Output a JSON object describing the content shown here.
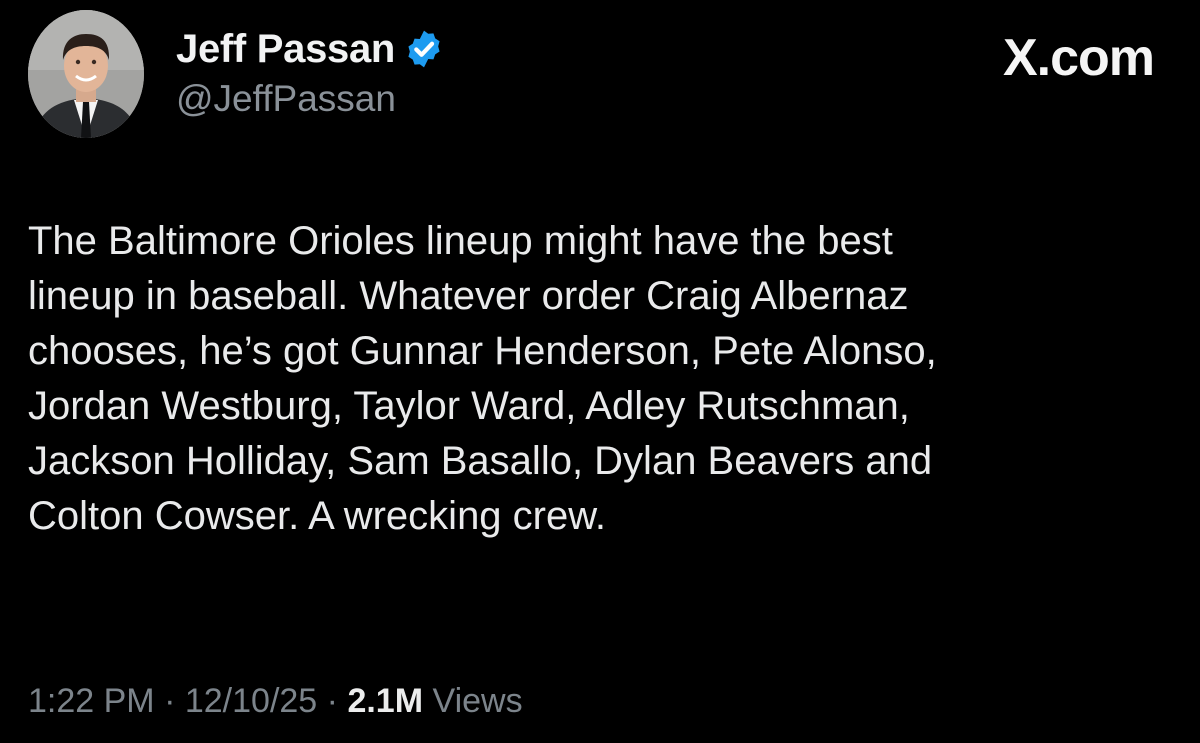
{
  "author": {
    "display_name": "Jeff Passan",
    "handle": "@JeffPassan",
    "verified": true
  },
  "brand": {
    "label": "X.com"
  },
  "tweet": {
    "lines": [
      "The Baltimore Orioles lineup might have the best",
      "lineup in baseball. Whatever order Craig Albernaz",
      "chooses, he’s got Gunnar Henderson, Pete Alonso,",
      "Jordan Westburg, Taylor Ward, Adley Rutschman,",
      "Jackson Holliday, Sam Basallo, Dylan Beavers and",
      "Colton Cowser. A wrecking crew."
    ]
  },
  "meta": {
    "time": "1:22 PM",
    "separator": "·",
    "date": "12/10/25",
    "views_count": "2.1M",
    "views_label": "Views"
  },
  "colors": {
    "background": "#000000",
    "verified_badge": "#1d9bf0",
    "secondary_text": "#7c848b"
  }
}
